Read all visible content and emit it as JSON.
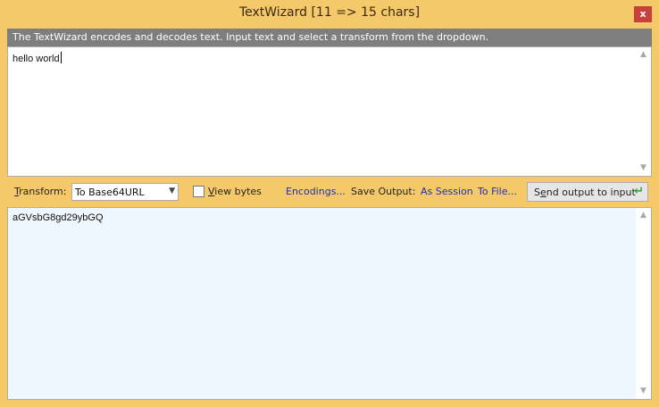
{
  "window": {
    "title": "TextWizard [11 => 15 chars]",
    "close_glyph": "x"
  },
  "description": "The TextWizard encodes and decodes text. Input text and select a transform from the dropdown.",
  "input": {
    "value": "hello world"
  },
  "toolbar": {
    "transform_prefix": "T",
    "transform_underlined": "ransform",
    "transform_suffix": ":",
    "transform_value": "To Base64URL",
    "view_bytes_u": "V",
    "view_bytes_rest": "iew bytes",
    "view_bytes_checked": false,
    "encodings_label": "Encodings...",
    "save_output_label": "Save Output:",
    "as_session_label": "As Session",
    "to_file_label": "To File...",
    "send_prefix": "S",
    "send_underlined": "e",
    "send_rest": "nd output to input"
  },
  "output": {
    "value": "aGVsbG8gd29ybGQ"
  },
  "colors": {
    "window_bg": "#f5c96a",
    "desc_bg": "#7e7e7e",
    "output_bg": "#eef7fd",
    "link": "#1a2fb8",
    "close": "#c7413a"
  },
  "icons": [
    "close-icon",
    "dropdown-arrow-icon",
    "scroll-up-icon",
    "scroll-down-icon",
    "send-arrow-icon"
  ]
}
